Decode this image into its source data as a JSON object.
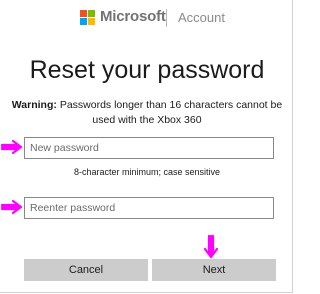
{
  "header": {
    "brand": "Microsoft",
    "section": "Account",
    "logo_colors": [
      "#f25022",
      "#7fba00",
      "#00a4ef",
      "#ffb900"
    ]
  },
  "title": "Reset your password",
  "warning": {
    "label": "Warning:",
    "text": "Passwords longer than 16 characters cannot be used with the Xbox 360"
  },
  "new_password": {
    "placeholder": "New password",
    "value": ""
  },
  "password_hint": "8-character minimum; case sensitive",
  "reenter_password": {
    "placeholder": "Reenter password",
    "value": ""
  },
  "buttons": {
    "cancel": "Cancel",
    "next": "Next"
  },
  "annotation_color": "#ff00ff"
}
